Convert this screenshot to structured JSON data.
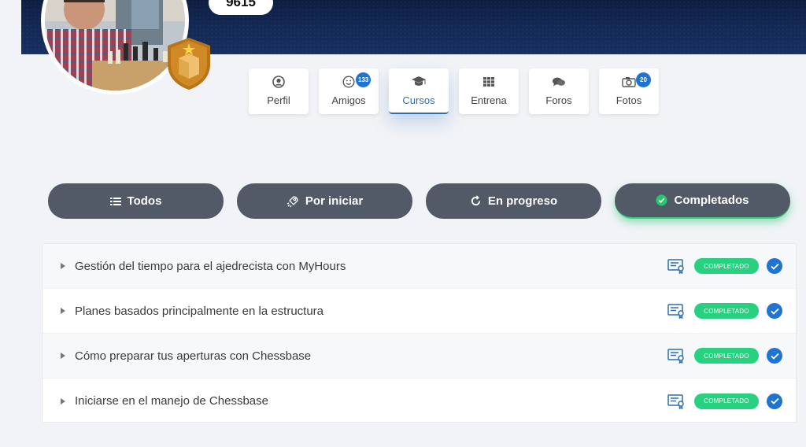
{
  "header": {
    "score": "9615"
  },
  "tabs": [
    {
      "label": "Perfil",
      "icon": "user-icon"
    },
    {
      "label": "Amigos",
      "icon": "smile-icon",
      "count": "133"
    },
    {
      "label": "Cursos",
      "icon": "graduation-cap-icon",
      "active": true
    },
    {
      "label": "Entrena",
      "icon": "grid-icon"
    },
    {
      "label": "Foros",
      "icon": "chat-bubbles-icon"
    },
    {
      "label": "Fotos",
      "icon": "camera-icon",
      "count": "20"
    }
  ],
  "filters": [
    {
      "label": "Todos",
      "icon": "list-icon"
    },
    {
      "label": "Por iniciar",
      "icon": "rocket-icon"
    },
    {
      "label": "En progreso",
      "icon": "refresh-icon"
    },
    {
      "label": "Completados",
      "icon": "check-circle-icon",
      "active": true
    }
  ],
  "courses": [
    {
      "title": "Gestión del tiempo para el ajedrecista con MyHours",
      "status": "COMPLETADO"
    },
    {
      "title": "Planes basados principalmente en la estructura",
      "status": "COMPLETADO"
    },
    {
      "title": "Cómo preparar tus aperturas con Chessbase",
      "status": "COMPLETADO"
    },
    {
      "title": "Iniciarse en el manejo de Chessbase",
      "status": "COMPLETADO"
    }
  ],
  "colors": {
    "cover": "#142a58",
    "accent_blue": "#1f74d1",
    "status_green": "#27d17f",
    "filter_bg": "#515a66"
  }
}
